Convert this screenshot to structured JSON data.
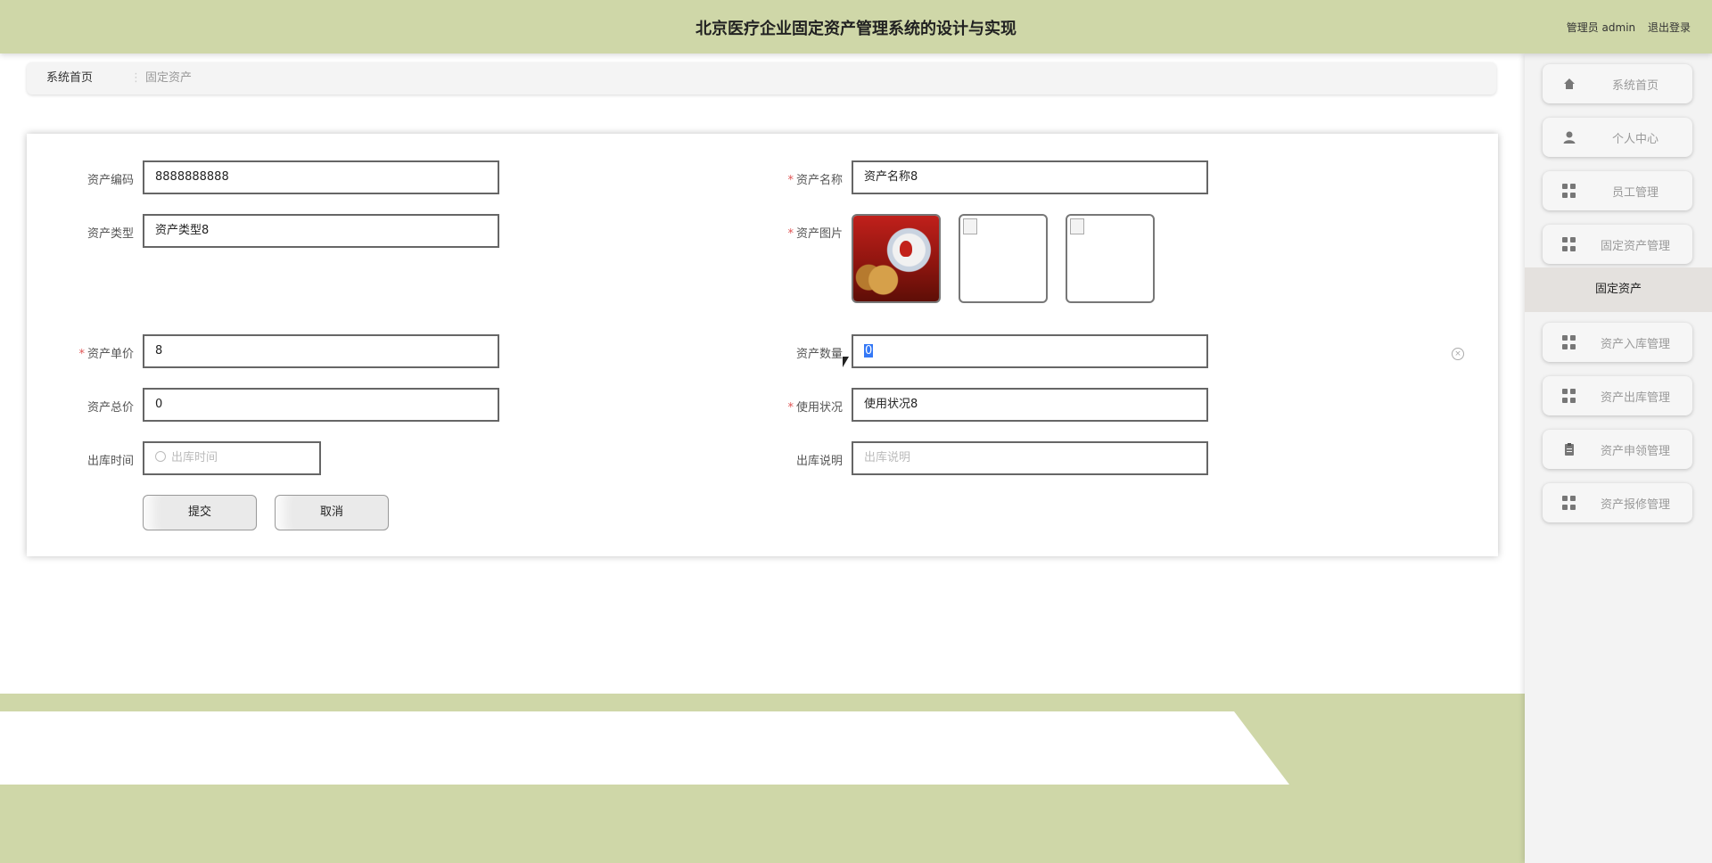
{
  "header": {
    "title": "北京医疗企业固定资产管理系统的设计与实现",
    "user_label": "管理员 admin",
    "logout_label": "退出登录"
  },
  "breadcrumb": {
    "home": "系统首页",
    "separator": "⋮",
    "current": "固定资产"
  },
  "form": {
    "asset_code": {
      "label": "资产编码",
      "value": "8888888888",
      "required": false
    },
    "asset_name": {
      "label": "资产名称",
      "value": "资产名称8",
      "required": true
    },
    "asset_type": {
      "label": "资产类型",
      "value": "资产类型8",
      "required": false
    },
    "asset_image": {
      "label": "资产图片",
      "required": true
    },
    "unit_price": {
      "label": "资产单价",
      "value": "8",
      "required": true
    },
    "quantity": {
      "label": "资产数量",
      "value": "0",
      "required": false
    },
    "total_price": {
      "label": "资产总价",
      "value": "0",
      "required": false
    },
    "usage_status": {
      "label": "使用状况",
      "value": "使用状况8",
      "required": true
    },
    "outbound_time": {
      "label": "出库时间",
      "placeholder": "出库时间",
      "required": false
    },
    "outbound_note": {
      "label": "出库说明",
      "placeholder": "出库说明",
      "required": false
    },
    "required_mark": "*",
    "submit_label": "提交",
    "cancel_label": "取消",
    "clear_symbol": "×"
  },
  "sidebar": {
    "items": [
      {
        "label": "系统首页",
        "icon": "home-icon"
      },
      {
        "label": "个人中心",
        "icon": "user-icon"
      },
      {
        "label": "员工管理",
        "icon": "grid-icon"
      },
      {
        "label": "固定资产管理",
        "icon": "grid-icon"
      },
      {
        "label": "资产入库管理",
        "icon": "grid-icon"
      },
      {
        "label": "资产出库管理",
        "icon": "grid-icon"
      },
      {
        "label": "资产申领管理",
        "icon": "clipboard-icon"
      },
      {
        "label": "资产报修管理",
        "icon": "grid-icon"
      }
    ],
    "active_sub_item": "固定资产"
  },
  "colors": {
    "header_bg": "#cfd7a8",
    "required": "#e05555",
    "selection": "#3478f6"
  }
}
